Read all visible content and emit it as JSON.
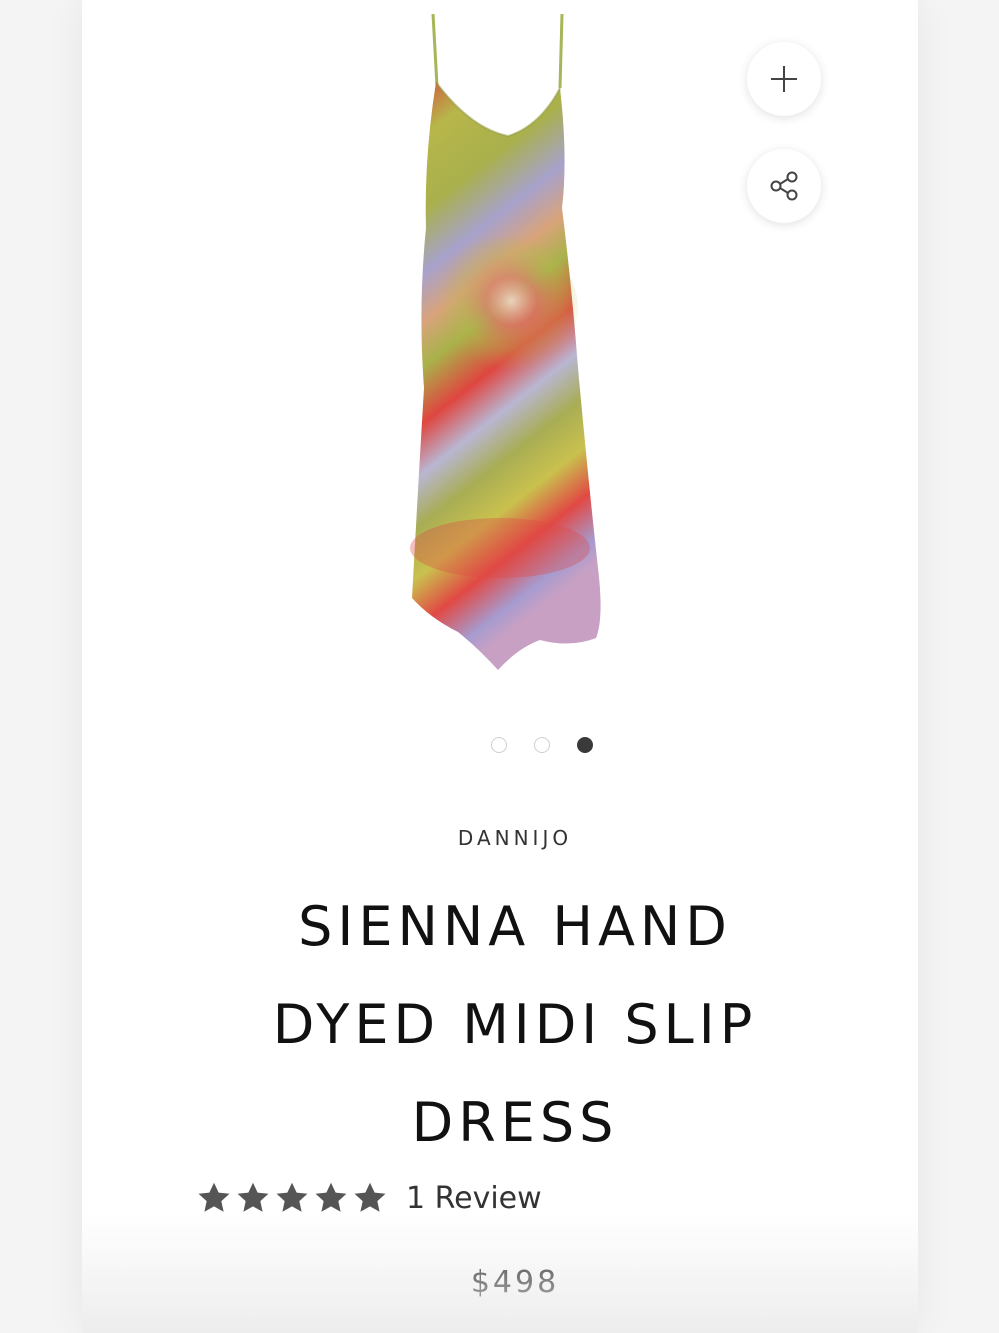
{
  "product": {
    "brand": "DANNIJO",
    "title": "SIENNA HAND DYED MIDI SLIP DRESS",
    "rating": 5,
    "rating_max": 5,
    "reviews_label": "1 Review",
    "price": "$498"
  },
  "gallery": {
    "image_count": 3,
    "active_index": 2
  },
  "icons": {
    "add": "plus-icon",
    "share": "share-icon",
    "star": "star-icon"
  },
  "colors": {
    "dot_active": "#3a3a3a",
    "dot_inactive": "#cfcfcf",
    "star": "#555555"
  }
}
